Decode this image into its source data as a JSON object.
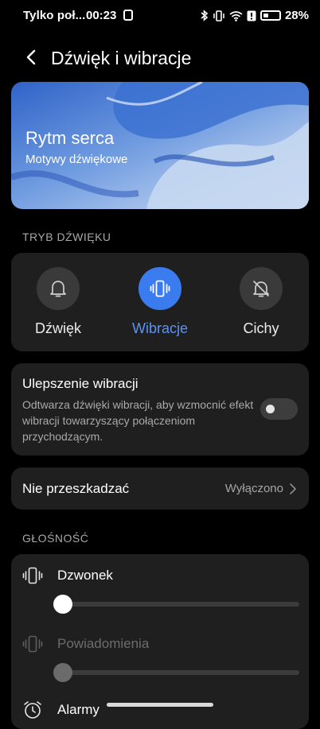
{
  "status_bar": {
    "carrier": "Tylko poł...",
    "time": "00:23",
    "battery": "28%"
  },
  "header": {
    "title": "Dźwięk i wibracje"
  },
  "banner": {
    "title": "Rytm serca",
    "subtitle": "Motywy dźwiękowe"
  },
  "sound_mode": {
    "section_label": "TRYB DŹWIĘKU",
    "options": [
      {
        "label": "Dźwięk",
        "icon": "bell-icon",
        "selected": false
      },
      {
        "label": "Wibracje",
        "icon": "vibrate-icon",
        "selected": true
      },
      {
        "label": "Cichy",
        "icon": "bell-off-icon",
        "selected": false
      }
    ],
    "accent_color": "#3a7bf0"
  },
  "vibration_enhancement": {
    "title": "Ulepszenie wibracji",
    "description": "Odtwarza dźwięki wibracji, aby wzmocnić efekt wibracji towarzyszący połączeniom przychodzącym.",
    "enabled": false
  },
  "do_not_disturb": {
    "title": "Nie przeszkadzać",
    "value": "Wyłączono"
  },
  "volume": {
    "section_label": "GŁOŚNOŚĆ",
    "items": [
      {
        "label": "Dzwonek",
        "icon": "vibrate-icon",
        "level": 0,
        "enabled": true
      },
      {
        "label": "Powiadomienia",
        "icon": "vibrate-icon",
        "level": 0,
        "enabled": false
      },
      {
        "label": "Alarmy",
        "icon": "alarm-icon",
        "level": 0,
        "enabled": true
      }
    ]
  }
}
